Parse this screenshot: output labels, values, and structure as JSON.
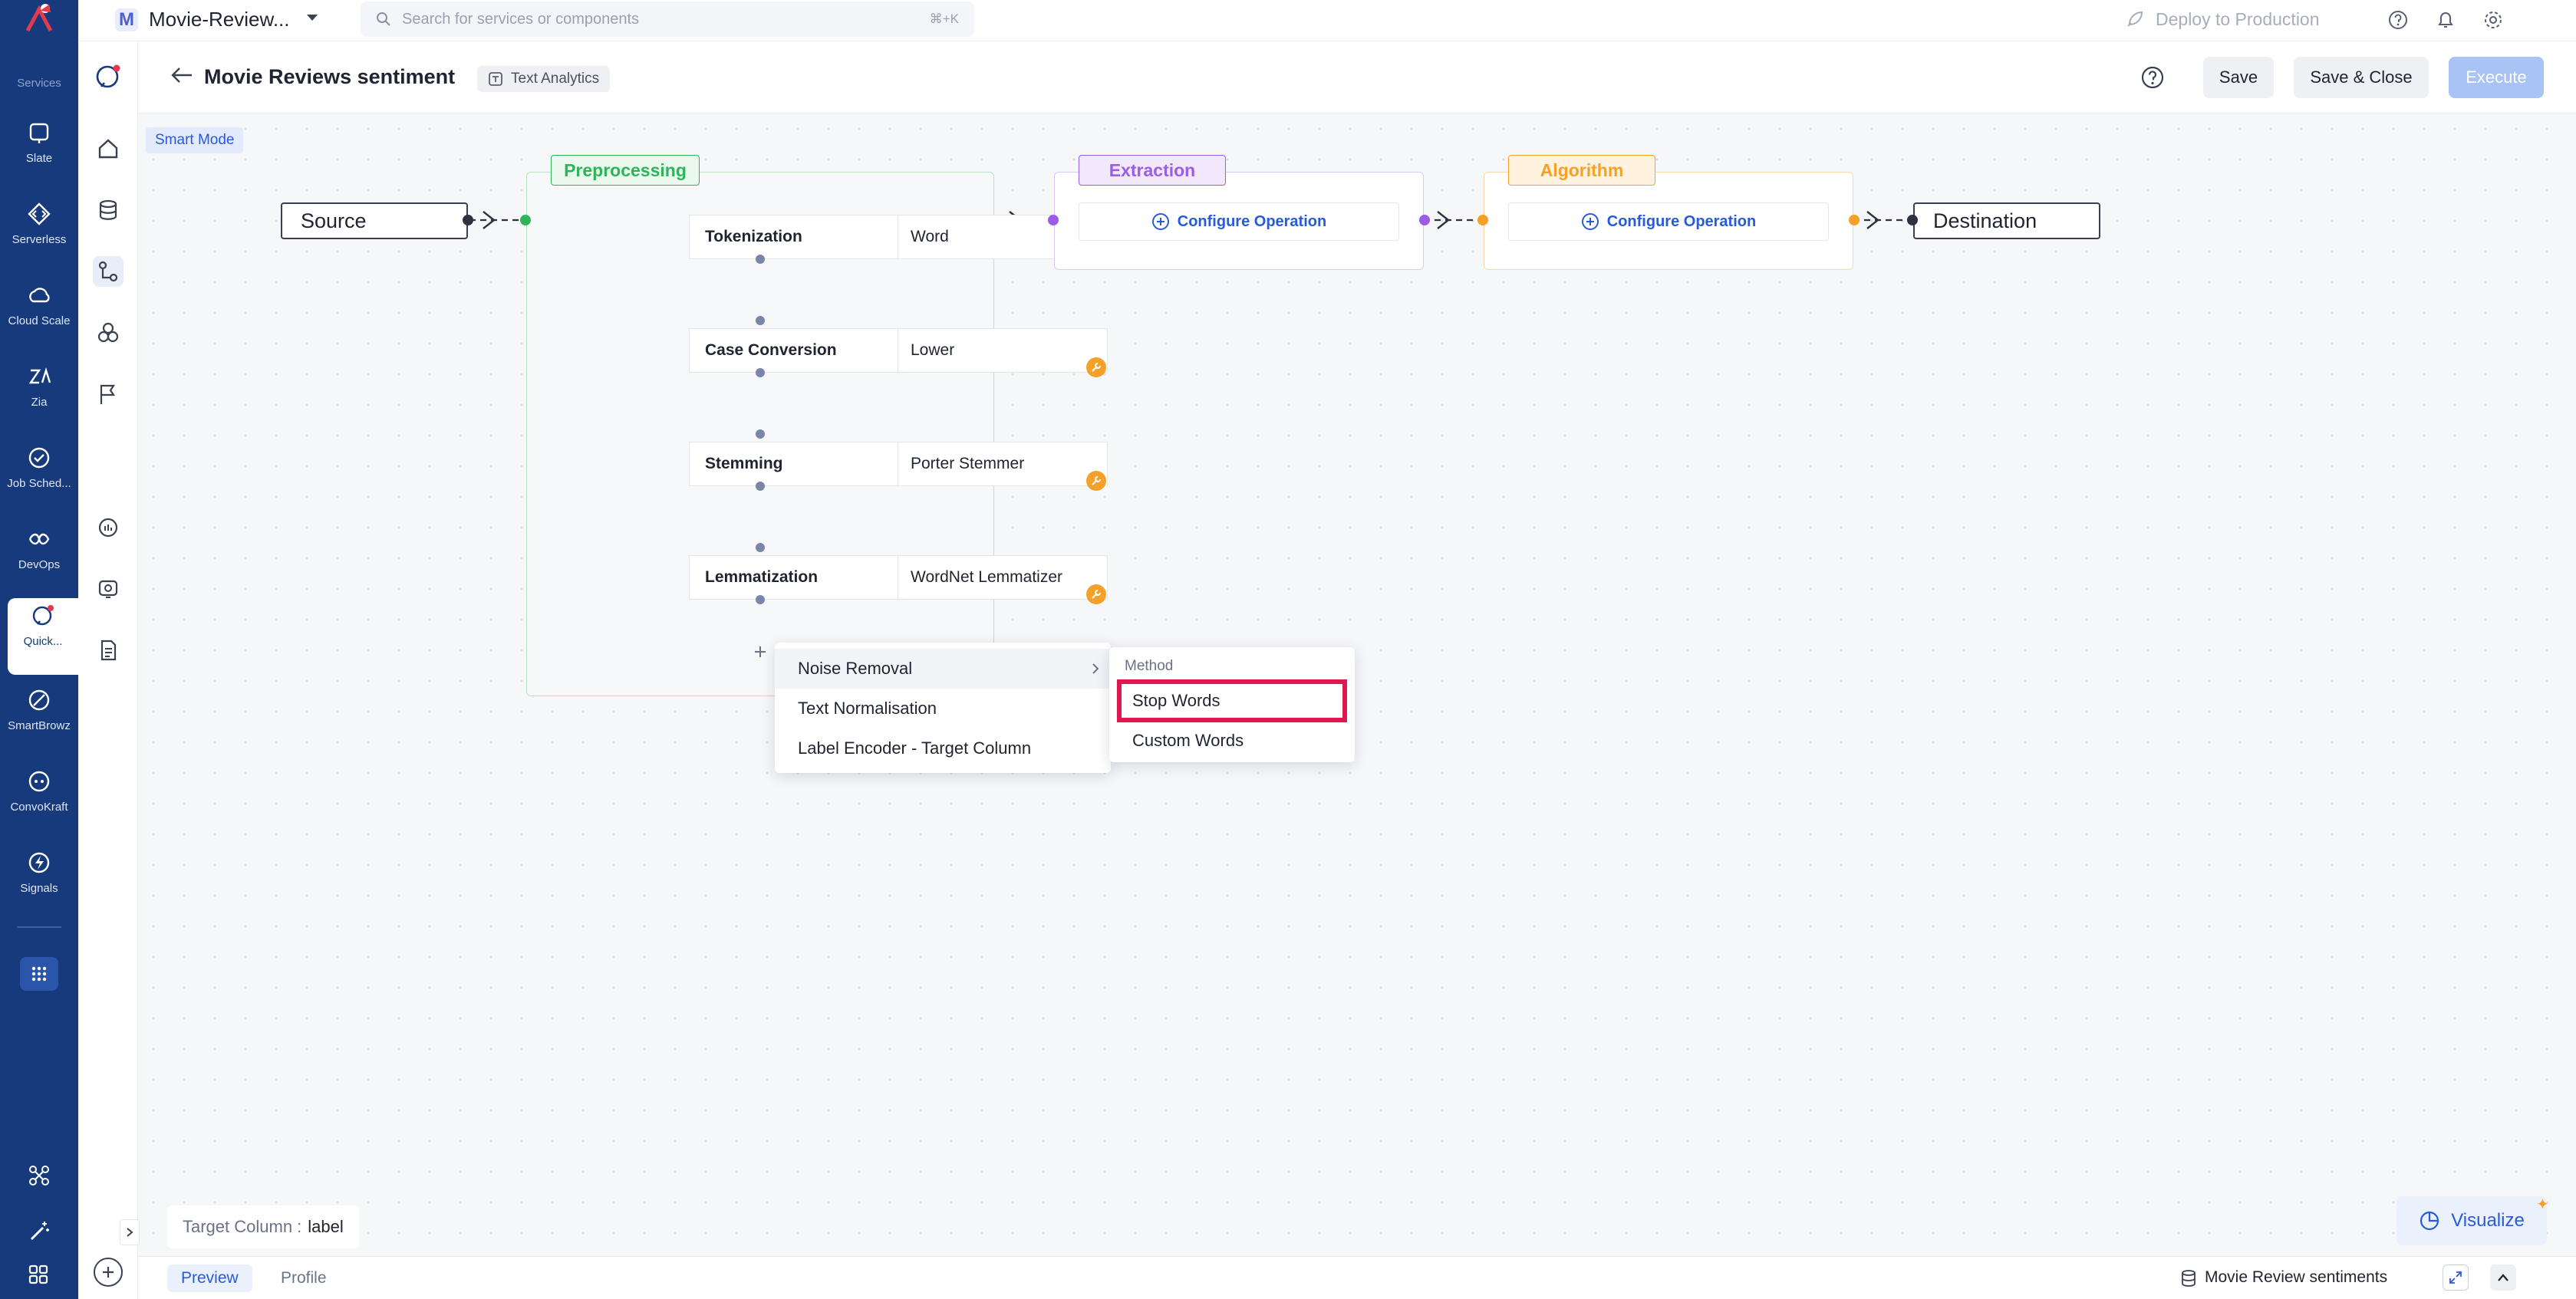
{
  "services_label": "Services",
  "services": [
    {
      "label": "Slate",
      "icon": "slate-icon"
    },
    {
      "label": "Serverless",
      "icon": "serverless-icon"
    },
    {
      "label": "Cloud Scale",
      "icon": "cloud-scale-icon"
    },
    {
      "label": "Zia",
      "icon": "zia-icon"
    },
    {
      "label": "Job Sched...",
      "icon": "job-scheduler-icon"
    },
    {
      "label": "DevOps",
      "icon": "devops-icon"
    },
    {
      "label": "Quick...",
      "icon": "quickml-icon"
    },
    {
      "label": "SmartBrowz",
      "icon": "smartbrowz-icon"
    },
    {
      "label": "ConvoKraft",
      "icon": "convokraft-icon"
    },
    {
      "label": "Signals",
      "icon": "signals-icon"
    }
  ],
  "topbar": {
    "project_initial": "M",
    "project_name": "Movie-Review...",
    "search_placeholder": "Search for services or components",
    "search_shortcut": "⌘+K",
    "deploy_label": "Deploy to Production"
  },
  "header": {
    "title": "Movie Reviews sentiment",
    "badge": "Text Analytics",
    "save": "Save",
    "save_close": "Save & Close",
    "execute": "Execute"
  },
  "canvas": {
    "smart_mode": "Smart Mode",
    "source": "Source",
    "destination": "Destination",
    "preprocessing_tag": "Preprocessing",
    "extraction_tag": "Extraction",
    "algorithm_tag": "Algorithm",
    "configure_operation": "Configure Operation",
    "operations": [
      {
        "label": "Tokenization",
        "value": "Word"
      },
      {
        "label": "Case Conversion",
        "value": "Lower"
      },
      {
        "label": "Stemming",
        "value": "Porter Stemmer"
      },
      {
        "label": "Lemmatization",
        "value": "WordNet Lemmatizer"
      }
    ],
    "target_column_label": "Target Column :",
    "target_column_value": "label",
    "visualize": "Visualize"
  },
  "menu": {
    "items": [
      "Noise Removal",
      "Text Normalisation",
      "Label Encoder - Target Column"
    ],
    "submenu_header": "Method",
    "submenu_items": [
      "Stop Words",
      "Custom Words"
    ]
  },
  "bottom": {
    "tabs": [
      "Preview",
      "Profile"
    ],
    "dataset": "Movie Review sentiments"
  },
  "colors": {
    "navy": "#163a7c",
    "preprocessing": "#2fb45a",
    "extraction": "#9b5de5",
    "algorithm": "#f5a028",
    "highlight": "#e0174f",
    "link": "#2a5bd7"
  }
}
